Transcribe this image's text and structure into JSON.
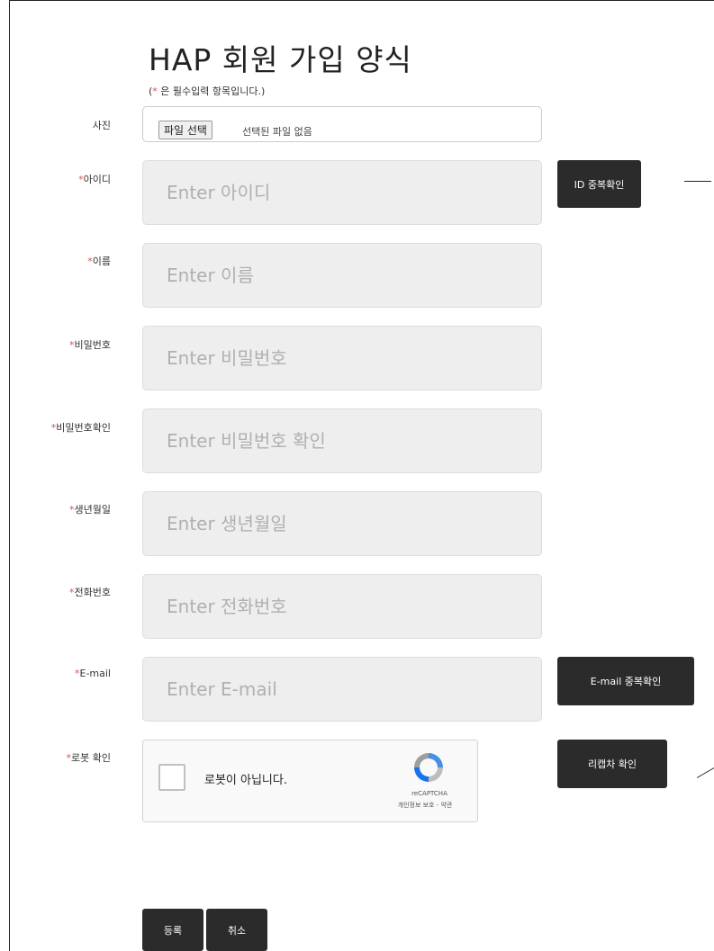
{
  "form": {
    "title": "HAP 회원 가입 양식",
    "required_star": "*",
    "required_note": " 은 필수입력 항목입니다.)",
    "required_note_prefix": "("
  },
  "photo": {
    "label": "사진",
    "file_button": "파일 선택",
    "file_status": "선택된 파일 없음"
  },
  "fields": {
    "id": {
      "label": "아이디",
      "placeholder": "Enter 아이디"
    },
    "name": {
      "label": "이름",
      "placeholder": "Enter 이름"
    },
    "password": {
      "label": "비밀번호",
      "placeholder": "Enter 비밀번호"
    },
    "password_confirm": {
      "label": "비밀번호확인",
      "placeholder": "Enter 비밀번호 확인"
    },
    "birthdate": {
      "label": "생년월일",
      "placeholder": "Enter 생년월일"
    },
    "phone": {
      "label": "전화번호",
      "placeholder": "Enter 전화번호"
    },
    "email": {
      "label": "E-mail",
      "placeholder": "Enter E-mail"
    }
  },
  "buttons": {
    "id_check": "ID 중복확인",
    "email_check": "E-mail 중복확인",
    "captcha_check": "리캡차 확인",
    "submit": "등록",
    "cancel": "취소"
  },
  "captcha": {
    "label": "로봇 확인",
    "text": "로봇이 아닙니다.",
    "brand": "reCAPTCHA",
    "links": "개인정보 보호 - 약관"
  }
}
